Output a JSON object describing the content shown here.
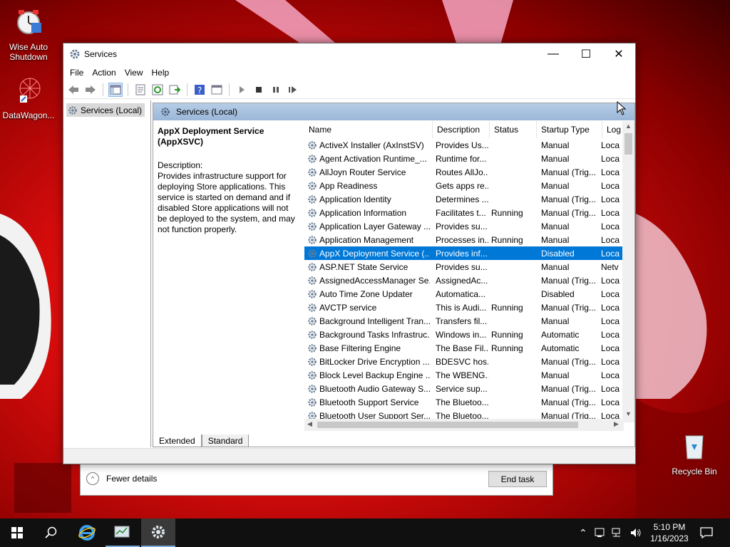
{
  "desktop": {
    "icons": [
      {
        "label": "Wise Auto Shutdown"
      },
      {
        "label": "DataWagon..."
      },
      {
        "label": "Recycle Bin"
      }
    ]
  },
  "window": {
    "title": "Services",
    "menu": [
      "File",
      "Action",
      "View",
      "Help"
    ]
  },
  "tree": {
    "root": "Services (Local)"
  },
  "pane": {
    "header": "Services (Local)",
    "selected_service": "AppX Deployment Service (AppXSVC)",
    "description_label": "Description:",
    "description": "Provides infrastructure support for deploying Store applications. This service is started on demand and if disabled Store applications will not be deployed to the system, and may not function properly."
  },
  "columns": [
    "Name",
    "Description",
    "Status",
    "Startup Type",
    "Log"
  ],
  "services": [
    {
      "name": "ActiveX Installer (AxInstSV)",
      "desc": "Provides Us...",
      "status": "",
      "startup": "Manual",
      "log": "Loca"
    },
    {
      "name": "Agent Activation Runtime_...",
      "desc": "Runtime for...",
      "status": "",
      "startup": "Manual",
      "log": "Loca"
    },
    {
      "name": "AllJoyn Router Service",
      "desc": "Routes AllJo...",
      "status": "",
      "startup": "Manual (Trig...",
      "log": "Loca"
    },
    {
      "name": "App Readiness",
      "desc": "Gets apps re...",
      "status": "",
      "startup": "Manual",
      "log": "Loca"
    },
    {
      "name": "Application Identity",
      "desc": "Determines ...",
      "status": "",
      "startup": "Manual (Trig...",
      "log": "Loca"
    },
    {
      "name": "Application Information",
      "desc": "Facilitates t...",
      "status": "Running",
      "startup": "Manual (Trig...",
      "log": "Loca"
    },
    {
      "name": "Application Layer Gateway ...",
      "desc": "Provides su...",
      "status": "",
      "startup": "Manual",
      "log": "Loca"
    },
    {
      "name": "Application Management",
      "desc": "Processes in...",
      "status": "Running",
      "startup": "Manual",
      "log": "Loca"
    },
    {
      "name": "AppX Deployment Service (...",
      "desc": "Provides inf...",
      "status": "",
      "startup": "Disabled",
      "log": "Loca"
    },
    {
      "name": "ASP.NET State Service",
      "desc": "Provides su...",
      "status": "",
      "startup": "Manual",
      "log": "Netv"
    },
    {
      "name": "AssignedAccessManager Se...",
      "desc": "AssignedAc...",
      "status": "",
      "startup": "Manual (Trig...",
      "log": "Loca"
    },
    {
      "name": "Auto Time Zone Updater",
      "desc": "Automatica...",
      "status": "",
      "startup": "Disabled",
      "log": "Loca"
    },
    {
      "name": "AVCTP service",
      "desc": "This is Audi...",
      "status": "Running",
      "startup": "Manual (Trig...",
      "log": "Loca"
    },
    {
      "name": "Background Intelligent Tran...",
      "desc": "Transfers fil...",
      "status": "",
      "startup": "Manual",
      "log": "Loca"
    },
    {
      "name": "Background Tasks Infrastruc...",
      "desc": "Windows in...",
      "status": "Running",
      "startup": "Automatic",
      "log": "Loca"
    },
    {
      "name": "Base Filtering Engine",
      "desc": "The Base Fil...",
      "status": "Running",
      "startup": "Automatic",
      "log": "Loca"
    },
    {
      "name": "BitLocker Drive Encryption ...",
      "desc": "BDESVC hos...",
      "status": "",
      "startup": "Manual (Trig...",
      "log": "Loca"
    },
    {
      "name": "Block Level Backup Engine ...",
      "desc": "The WBENG...",
      "status": "",
      "startup": "Manual",
      "log": "Loca"
    },
    {
      "name": "Bluetooth Audio Gateway S...",
      "desc": "Service sup...",
      "status": "",
      "startup": "Manual (Trig...",
      "log": "Loca"
    },
    {
      "name": "Bluetooth Support Service",
      "desc": "The Bluetoo...",
      "status": "",
      "startup": "Manual (Trig...",
      "log": "Loca"
    },
    {
      "name": "Bluetooth User Support Ser...",
      "desc": "The Bluetoo...",
      "status": "",
      "startup": "Manual (Trig...",
      "log": "Loca"
    }
  ],
  "selected_index": 8,
  "tabs": [
    "Extended",
    "Standard"
  ],
  "taskmanager": {
    "fewer_details": "Fewer details",
    "end_task": "End task"
  },
  "taskbar": {
    "time": "5:10 PM",
    "date": "1/16/2023"
  },
  "colors": {
    "selection": "#0078d7",
    "pane_header": "#a9c2df"
  }
}
